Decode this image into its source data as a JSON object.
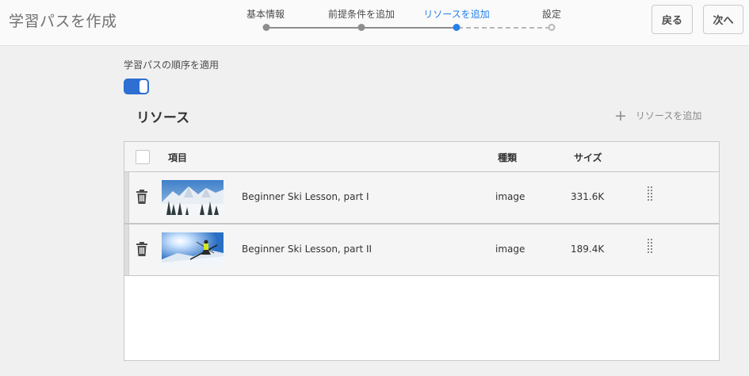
{
  "header": {
    "title": "学習パスを作成",
    "steps": [
      {
        "label": "基本情報",
        "state": "done"
      },
      {
        "label": "前提条件を追加",
        "state": "done"
      },
      {
        "label": "リソースを追加",
        "state": "active"
      },
      {
        "label": "設定",
        "state": "future"
      }
    ],
    "back_label": "戻る",
    "next_label": "次へ"
  },
  "order_toggle": {
    "label": "学習パスの順序を適用",
    "checked": true
  },
  "resources": {
    "title": "リソース",
    "add_label": "リソースを追加",
    "columns": {
      "item": "項目",
      "type": "種類",
      "size": "サイズ"
    },
    "rows": [
      {
        "name": "Beginner Ski Lesson, part I",
        "type": "image",
        "size": "331.6K",
        "thumbnail": "snowy-mountain-forest"
      },
      {
        "name": "Beginner Ski Lesson, part II",
        "type": "image",
        "size": "189.4K",
        "thumbnail": "skier-jumping"
      }
    ]
  },
  "colors": {
    "accent": "#2680eb",
    "toggle": "#2d6fd2"
  }
}
